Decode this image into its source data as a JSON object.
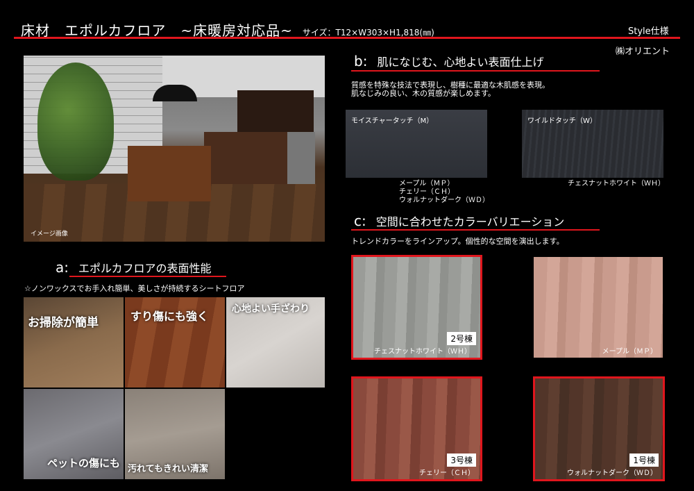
{
  "header": {
    "title": "床材　エポルカフロア　~床暖房対応品~",
    "size": "サイズ：T12×W303×H1,818(㎜)",
    "style": "Style仕様",
    "company": "㈱オリエント"
  },
  "main_photo": {
    "caption": "イメージ画像"
  },
  "section_a": {
    "letter": "a:",
    "title": "エポルカフロアの表面性能",
    "desc": "☆ノンワックスでお手入れ簡単、美しさが持続するシートフロア",
    "tiles": [
      {
        "label": "お掃除が簡単"
      },
      {
        "label": "すり傷にも強く"
      },
      {
        "label": "心地よい手ざわり"
      },
      {
        "label": "ペットの傷にも"
      },
      {
        "label": "汚れてもきれい清潔"
      }
    ]
  },
  "section_b": {
    "letter": "b:",
    "title": "肌になじむ、心地よい表面仕上げ",
    "desc_line1": "質感を特殊な技法で表現し、樹種に最適な木肌感を表現。",
    "desc_line2": "肌なじみの良い、木の質感が楽しめます。",
    "moist": {
      "label": "モイスチャータッチ（M）",
      "species": [
        "メープル（ＭＰ）",
        "チェリー（ＣＨ）",
        "ウォルナットダーク（ＷＤ）"
      ]
    },
    "wild": {
      "label": "ワイルドタッチ（W）",
      "species": [
        "チェスナットホワイト（ＷＨ）"
      ]
    }
  },
  "section_c": {
    "letter": "c:",
    "title": "空間に合わせたカラーバリエーション",
    "desc": "トレンドカラーをラインアップ。個性的な空間を演出します。",
    "swatches": [
      {
        "name": "チェスナットホワイト（ＷＨ）",
        "building": "2号棟"
      },
      {
        "name": "メープル（ＭＰ）",
        "building": ""
      },
      {
        "name": "チェリー（ＣＨ）",
        "building": "3号棟"
      },
      {
        "name": "ウォルナットダーク（ＷＤ）",
        "building": "1号棟"
      }
    ]
  },
  "colors": {
    "accent": "#e0161d",
    "background": "#000000"
  }
}
